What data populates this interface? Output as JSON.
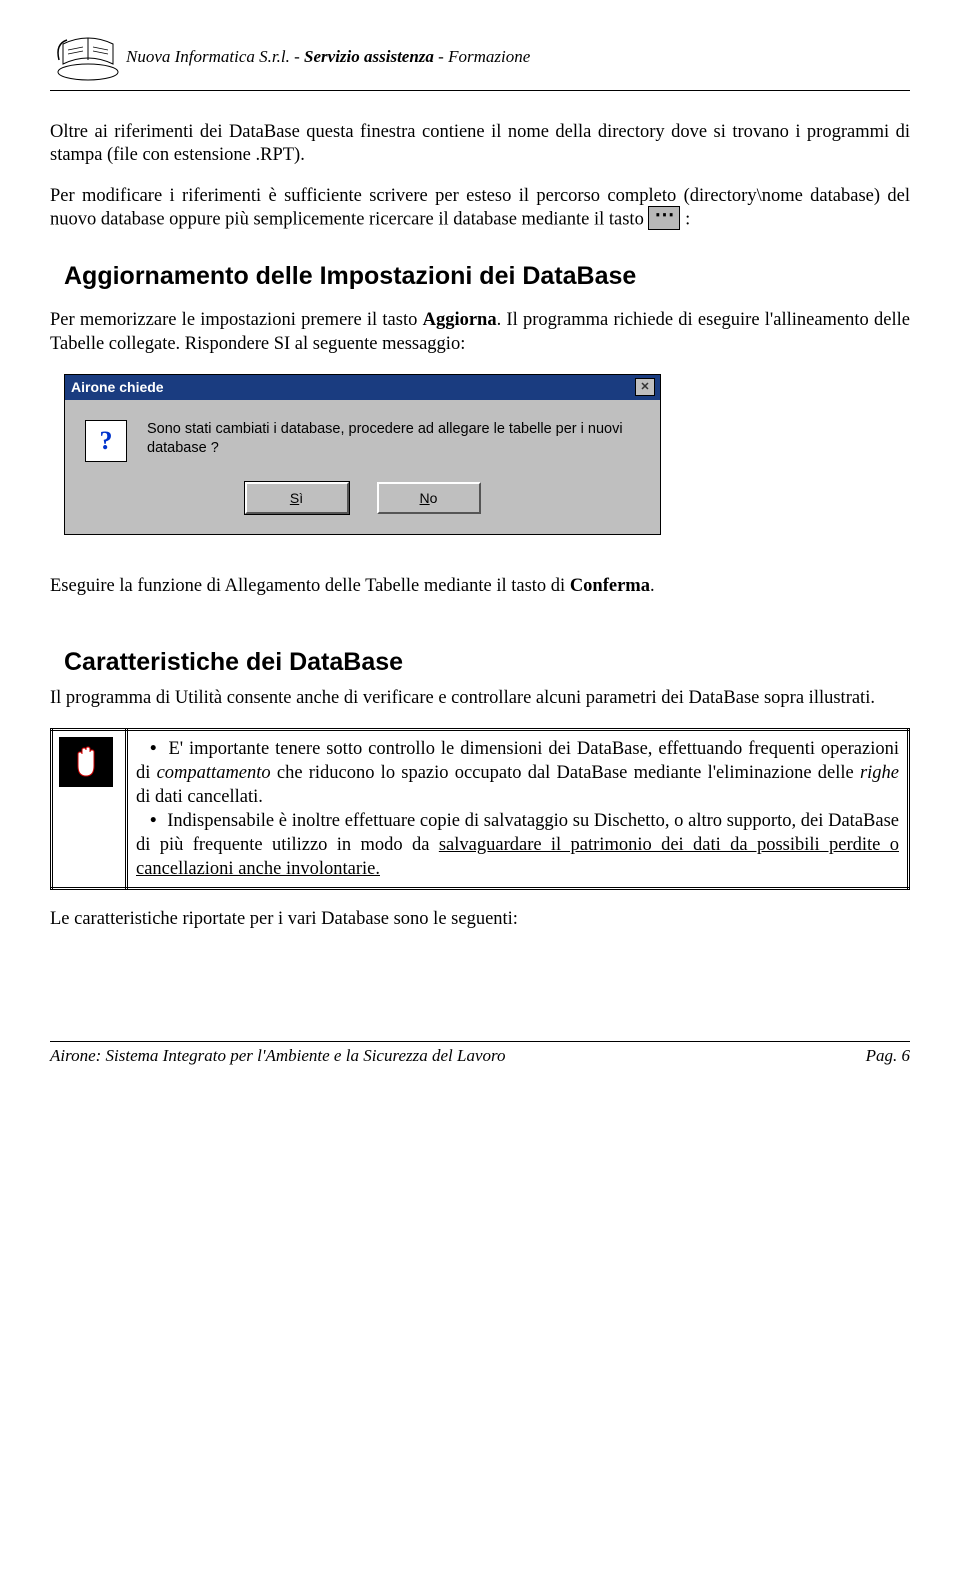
{
  "header": {
    "company": "Nuova Informatica S.r.l.",
    "sep1": "  -  ",
    "svc": "Servizio assistenza",
    "sep2": " - ",
    "training": "Formazione"
  },
  "p1_a": "Oltre ai riferimenti dei DataBase questa finestra contiene il nome della directory dove si trovano i programmi di stampa (file con estensione .RPT).",
  "p2_a": "Per modificare i riferimenti è sufficiente scrivere per esteso il percorso completo (directory\\nome database) del nuovo database oppure più semplicemente ricercare il database mediante il tasto ",
  "p2_b": " :",
  "h1": "Aggiornamento delle Impostazioni dei DataBase",
  "p3_a": "Per memorizzare le impostazioni premere il tasto ",
  "p3_bold": "Aggiorna",
  "p3_b": ". Il programma richiede di eseguire l'allineamento delle Tabelle collegate. Rispondere SI al seguente messaggio:",
  "dialog": {
    "title": "Airone chiede",
    "msg": "Sono stati cambiati i database, procedere ad allegare le tabelle per i nuovi database ?",
    "yes_u": "S",
    "yes_r": "ì",
    "no_u": "N",
    "no_r": "o"
  },
  "p4_a": "Eseguire la funzione di Allegamento delle Tabelle mediante il tasto di ",
  "p4_bold": "Conferma",
  "p4_b": ".",
  "h2": "Caratteristiche dei DataBase",
  "p5": "Il programma di Utilità consente anche di verificare e controllare alcuni parametri dei DataBase sopra illustrati.",
  "note": {
    "b1_a": "E' importante tenere sotto controllo le dimensioni dei DataBase, effettuando frequenti operazioni di ",
    "b1_i": "compattamento",
    "b1_b": " che riducono lo spazio occupato dal DataBase mediante l'eliminazione delle ",
    "b1_i2": "righe",
    "b1_c": " di dati cancellati.",
    "b2_a": "Indispensabile è inoltre effettuare copie di salvataggio su Dischetto, o altro supporto, dei DataBase di più frequente utilizzo in modo da ",
    "b2_u": "salvaguardare il patrimonio dei dati da possibili perdite o cancellazioni anche involontarie."
  },
  "p6": "Le caratteristiche riportate per i vari Database sono le seguenti:",
  "footer": {
    "left": "Airone: Sistema Integrato per l'Ambiente e la Sicurezza del Lavoro",
    "right": "Pag. 6"
  }
}
